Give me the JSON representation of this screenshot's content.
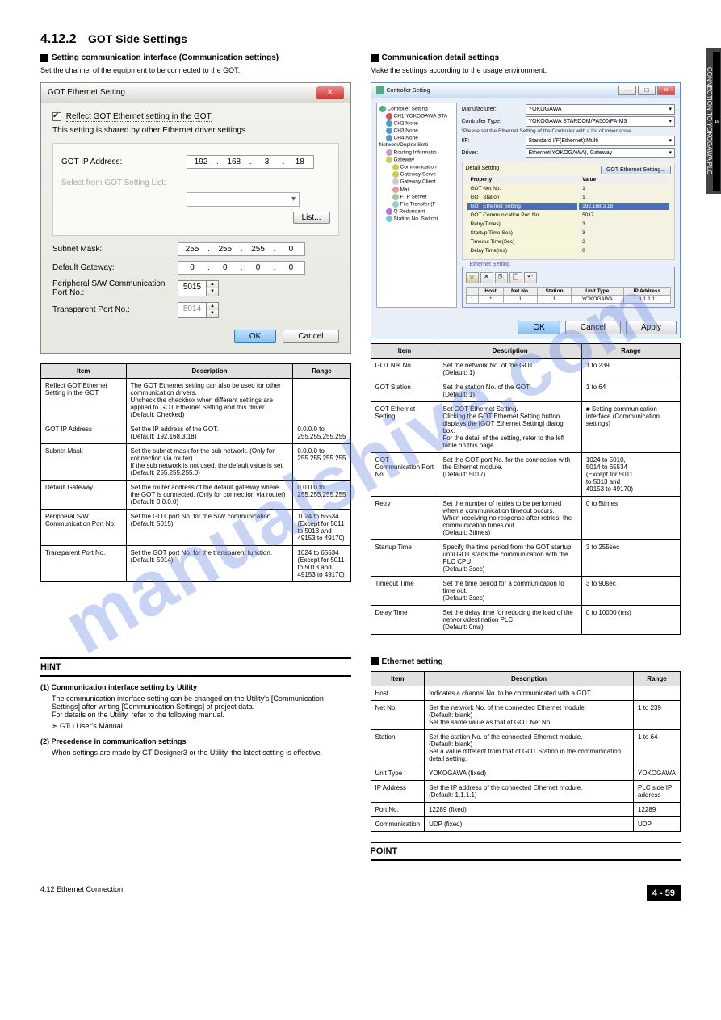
{
  "section1": {
    "num": "4.12.2",
    "title": "GOT Side Settings",
    "sub1": "Setting communication interface (Communication settings)",
    "para1": "Set the channel of the equipment to be connected to the GOT.",
    "sub2": "Communication detail settings",
    "para2": "Make the settings according to the usage environment."
  },
  "dlg1": {
    "title": "GOT Ethernet Setting",
    "reflect": "Reflect GOT Ethernet setting in the GOT",
    "shared": "This setting is shared by other Ethernet driver settings.",
    "ip_label": "GOT IP Address:",
    "ip": [
      "192",
      "168",
      "3",
      "18"
    ],
    "selectfrom": "Select from GOT Setting List:",
    "list_btn": "List...",
    "subnet_label": "Subnet Mask:",
    "subnet": [
      "255",
      "255",
      "255",
      "0"
    ],
    "gw_label": "Default Gateway:",
    "gw": [
      "0",
      "0",
      "0",
      "0"
    ],
    "psw_label": "Peripheral S/W Communication Port No.:",
    "psw_val": "5015",
    "tport_label": "Transparent Port No.:",
    "tport_val": "5014",
    "ok": "OK",
    "cancel": "Cancel"
  },
  "tbl1": {
    "h1": "Item",
    "h2": "Description",
    "h3": "Range",
    "rows": [
      [
        "Reflect GOT Ethernet Setting in the GOT",
        "The GOT Ethernet setting can also be used for other communication drivers.\nUncheck the checkbox when different settings are applied to GOT Ethernet Setting and this driver.\n(Default: Checked)",
        ""
      ],
      [
        "GOT IP Address",
        "Set the IP address of the GOT.\n(Default: 192.168.3.18)",
        "0.0.0.0 to\n255.255.255.255"
      ],
      [
        "Subnet Mask",
        "Set the subnet mask for the sub network. (Only for connection via router)\nIf the sub network is not used, the default value is set.\n(Default: 255.255.255.0)",
        "0.0.0.0 to\n255.255.255.255"
      ],
      [
        "Default Gateway",
        "Set the router address of the default gateway where the GOT is connected. (Only for connection via router)\n(Default: 0.0.0.0)",
        "0.0.0.0 to\n255.255.255.255"
      ],
      [
        "Peripheral S/W Communication Port No.",
        "Set the GOT port No. for the S/W communication.\n(Default: 5015)",
        "1024 to 65534\n(Except for 5011\nto 5013 and\n49153 to 49170)"
      ],
      [
        "Transparent Port No.",
        "Set the GOT port No. for the transparent function.\n(Default: 5014)",
        "1024 to 65534\n(Except for 5011\n to 5013 and\n49153 to 49170)"
      ]
    ]
  },
  "dlg2": {
    "title": "Controller Setting",
    "tree": {
      "root": "Controller Setting",
      "ch1": "CH1:YOKOGAWA STA",
      "ch2": "CH2:None",
      "ch3": "CH3:None",
      "ch4": "CH4:None",
      "net": "Network/Duplex Setti",
      "routing": "Routing Informatio",
      "gateway": "Gateway",
      "comm": "Communication",
      "gws": "Gateway Serve",
      "gwc": "Gateway Client",
      "mail": "Mail",
      "ftp": "FTP Server",
      "ft": "File Transfer (F",
      "qred": "Q Redundant",
      "sta": "Station No. Switchi"
    },
    "manufacturer_l": "Manufacturer:",
    "manufacturer_v": "YOKOGAWA",
    "ctype_l": "Controller Type:",
    "ctype_v": "YOKOGAWA STARDOM/FA500/FA-M3",
    "note": "*Please set the Ethernet Setting of the Controller with a list of lower scree",
    "if_l": "I/F:",
    "if_v": "Standard I/F(Ethernet):Multi",
    "drv_l": "Driver:",
    "drv_v": "Ethernet(YOKOGAWA), Gateway",
    "ds_l": "Detail Setting",
    "dsbtn": "GOT Ethernet Setting...",
    "det_h1": "Property",
    "det_h2": "Value",
    "det": [
      [
        "GOT Net No.",
        "1"
      ],
      [
        "GOT Station",
        "1"
      ],
      [
        "GOT Ethernet Setting",
        "192.168.3.18"
      ],
      [
        "GOT Communication Port No.",
        "5017"
      ],
      [
        "Retry(Times)",
        "3"
      ],
      [
        "Startup Time(Sec)",
        "3"
      ],
      [
        "Timeout Time(Sec)",
        "3"
      ],
      [
        "Delay Time(ms)",
        "0"
      ]
    ],
    "ethset": "Ethernet Setting",
    "eth_h": [
      "",
      "Host",
      "Net No.",
      "Station",
      "Unit Type",
      "IP Address"
    ],
    "eth_r": [
      "1",
      "*",
      "1",
      "1",
      "YOKOGAWA",
      "1.1.1.1"
    ],
    "ok": "OK",
    "cancel": "Cancel",
    "apply": "Apply"
  },
  "tbl2": {
    "h1": "Item",
    "h2": "Description",
    "h3": "Range",
    "rows": [
      [
        "GOT Net No.",
        "Set the network No. of the GOT.\n(Default: 1)",
        "1 to 239"
      ],
      [
        "GOT Station",
        "Set the station No. of the GOT.\n(Default: 1)",
        "1 to 64"
      ],
      [
        "GOT Ethernet Setting",
        "Set GOT Ethernet Setting.\nClicking the GOT Ethernet Setting button displays the [GOT Ethernet Setting] dialog box.\nFor the detail of the setting, refer to the left table on this page.",
        "■ Setting communication interface (Communication settings)"
      ],
      [
        "GOT Communication Port No.",
        "Set the GOT port No. for the connection with the Ethernet module.\n(Default: 5017)",
        "1024 to 5010,\n5014 to 65534\n(Except for 5011\nto 5013 and\n49153 to 49170)"
      ],
      [
        "Retry",
        "Set the number of retries to be performed when a communication timeout occurs.\nWhen receiving no response after retries, the communication times out.\n(Default: 3times)",
        "0 to 5times"
      ],
      [
        "Startup Time",
        "Specify the time period from the GOT startup until GOT starts the communication with the PLC CPU.\n(Default: 3sec)",
        "3 to 255sec"
      ],
      [
        "Timeout Time",
        "Set the time period for a communication to time out.\n(Default: 3sec)",
        "3 to 90sec"
      ],
      [
        "Delay Time",
        "Set the delay time for reducing the load of the network/destination PLC.\n(Default: 0ms)",
        "0 to 10000 (ms)"
      ]
    ]
  },
  "section2": {
    "h2": "Ethernet setting",
    "hint": {
      "title": "HINT",
      "h1": "Communication interface setting by Utility",
      "p1": "The communication interface setting can be changed on the Utility's [Communication Settings] after writing [Communication Settings] of project data.\nFor details on the Utility, refer to the following manual.",
      "ref1": "GT□ User's Manual",
      "h2": "Precedence in communication settings",
      "p2": "When settings are made by GT Designer3 or the Utility, the latest setting is effective."
    },
    "pt_title": "POINT",
    "pt": [
      [
        "Host",
        "Indicates a channel No. to be communicated with a GOT.",
        ""
      ],
      [
        "Net No.",
        "Set the network No. of the connected Ethernet module.\n(Default: blank)\nSet the same value as that of GOT Net No.",
        "1 to 239"
      ],
      [
        "Station",
        "Set the station No. of the connected Ethernet module.\n(Default: blank)\nSet a value different from that of GOT Station in the communication detail setting.",
        "1 to 64"
      ],
      [
        "Unit Type",
        "YOKOGAWA (fixed)",
        "YOKOGAWA"
      ],
      [
        "IP Address",
        "Set the IP address of the connected Ethernet module.\n(Default: 1.1.1.1)",
        "PLC side IP\naddress"
      ],
      [
        "Port No.",
        "12289 (fixed)",
        "12289"
      ],
      [
        "Communication",
        "UDP (fixed)",
        "UDP"
      ]
    ]
  },
  "sidetab": "CONNECTION TO YOKOGAWA PLC",
  "sidetab_num": "4",
  "footer": {
    "left": "4.12 Ethernet Connection",
    "right": "4 - 59"
  }
}
